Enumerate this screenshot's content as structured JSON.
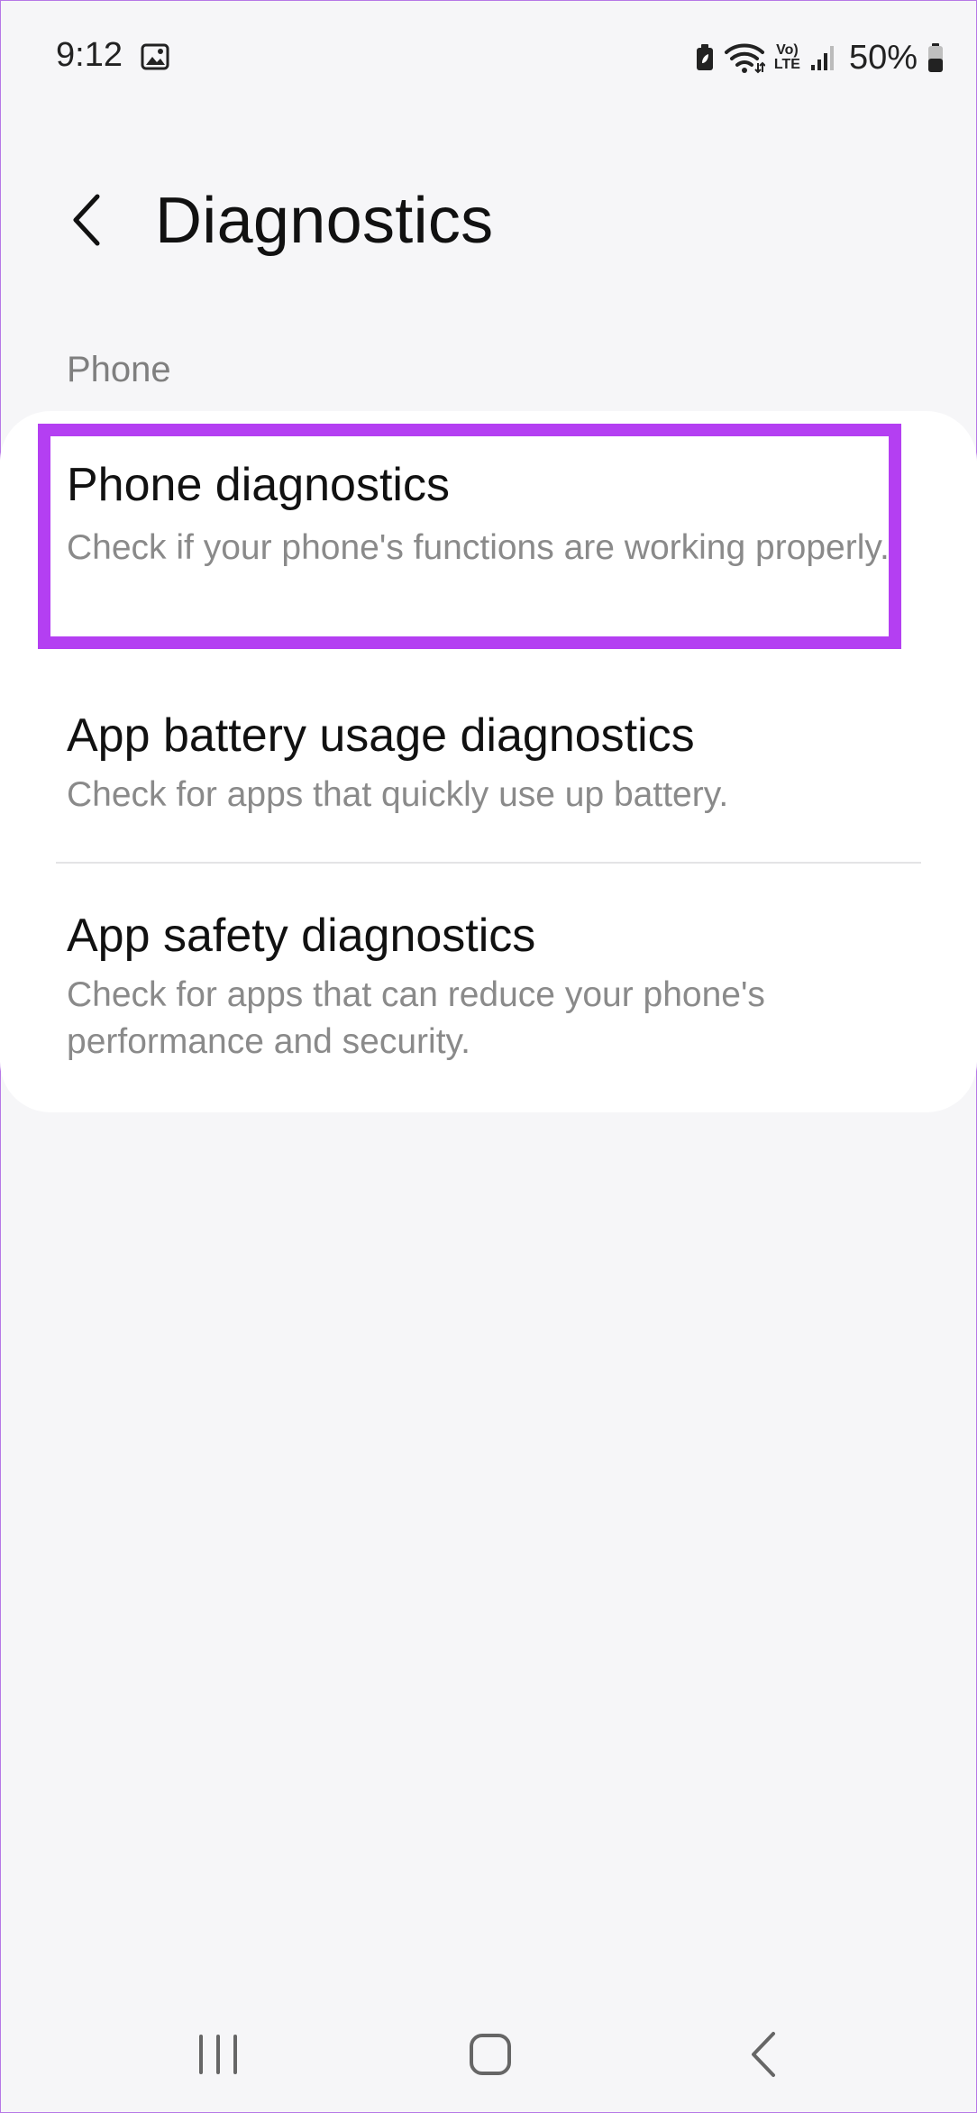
{
  "status_bar": {
    "time": "9:12",
    "battery_percent": "50%",
    "volte_top": "Vo)",
    "volte_bottom": "LTE",
    "icons": [
      "gallery-icon",
      "battery-saver-icon",
      "wifi-icon",
      "volte-icon",
      "signal-icon",
      "battery-icon"
    ]
  },
  "header": {
    "title": "Diagnostics",
    "back_icon": "chevron-left-icon"
  },
  "section": {
    "label": "Phone"
  },
  "items": [
    {
      "title": "Phone diagnostics",
      "subtitle": "Check if your phone's functions are working properly."
    },
    {
      "title": "App battery usage diagnostics",
      "subtitle": "Check for apps that quickly use up battery."
    },
    {
      "title": "App safety diagnostics",
      "subtitle": "Check for apps that can reduce your phone's performance and security."
    }
  ],
  "highlight": {
    "color": "#b43ff2",
    "target": "Phone diagnostics"
  },
  "nav_bar": {
    "icons": [
      "recents-icon",
      "home-icon",
      "back-icon"
    ]
  },
  "colors": {
    "background": "#f6f6f8",
    "card": "#ffffff",
    "title_text": "#111111",
    "subtitle_text": "#8a8a8a",
    "section_label": "#7f7f7f"
  }
}
